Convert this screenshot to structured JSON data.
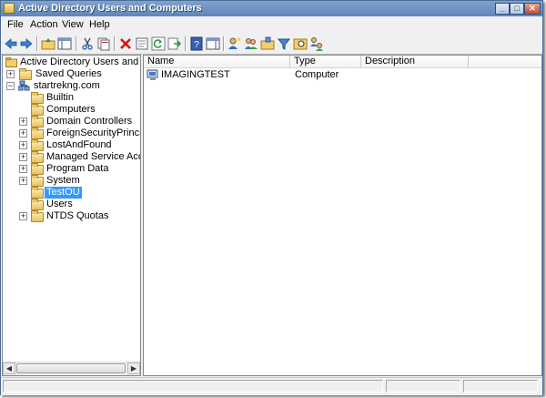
{
  "window": {
    "title": "Active Directory Users and Computers"
  },
  "menu": {
    "file": "File",
    "action": "Action",
    "view": "View",
    "help": "Help"
  },
  "tree": {
    "root": "Active Directory Users and Comput",
    "saved_queries": "Saved Queries",
    "domain": "startrekng.com",
    "children": [
      "Builtin",
      "Computers",
      "Domain Controllers",
      "ForeignSecurityPrincipals",
      "LostAndFound",
      "Managed Service Accounts",
      "Program Data",
      "System",
      "TestOU",
      "Users",
      "NTDS Quotas"
    ],
    "selected": "TestOU"
  },
  "list": {
    "columns": [
      "Name",
      "Type",
      "Description"
    ],
    "rows": [
      {
        "name": "IMAGINGTEST",
        "type": "Computer",
        "description": ""
      }
    ]
  }
}
